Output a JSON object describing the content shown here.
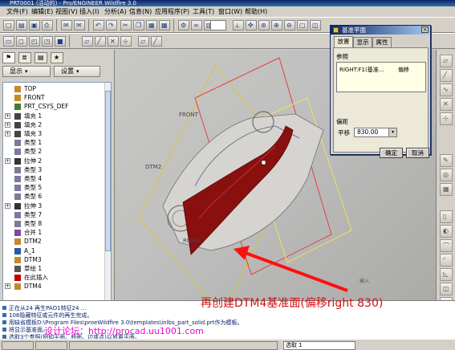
{
  "window": {
    "title": "PRT0001 (活动的) - Pro/ENGINEER Wildfire 3.0"
  },
  "menu": [
    "文件(F)",
    "编辑(E)",
    "视图(V)",
    "插入(I)",
    "分析(A)",
    "信息(N)",
    "应用程序(P)",
    "工具(T)",
    "窗口(W)",
    "帮助(H)"
  ],
  "left_panel": {
    "tabs": [
      "model-tree-tab",
      "layer-tab",
      "folder-tab",
      "favorites-tab"
    ],
    "show_label": "显示",
    "settings_label": "设置",
    "tree_items": [
      {
        "label": "TOP",
        "icon": "plane",
        "expand": false
      },
      {
        "label": "FRONT",
        "icon": "plane",
        "expand": false
      },
      {
        "label": "PRT_CSYS_DEF",
        "icon": "csys",
        "expand": false
      },
      {
        "label": "填充 1",
        "icon": "fill",
        "expand": true
      },
      {
        "label": "填充 2",
        "icon": "fill",
        "expand": true
      },
      {
        "label": "填充 3",
        "icon": "fill",
        "expand": true
      },
      {
        "label": "类型 1",
        "icon": "type",
        "expand": false
      },
      {
        "label": "类型 2",
        "icon": "type",
        "expand": false
      },
      {
        "label": "拉伸 2",
        "icon": "extrude",
        "expand": true
      },
      {
        "label": "类型 3",
        "icon": "type",
        "expand": false
      },
      {
        "label": "类型 4",
        "icon": "type",
        "expand": false
      },
      {
        "label": "类型 5",
        "icon": "type",
        "expand": false
      },
      {
        "label": "类型 6",
        "icon": "type",
        "expand": false
      },
      {
        "label": "拉伸 3",
        "icon": "extrude",
        "expand": true
      },
      {
        "label": "类型 7",
        "icon": "type",
        "expand": false
      },
      {
        "label": "类型 8",
        "icon": "type",
        "expand": false
      },
      {
        "label": "合并 1",
        "icon": "merge",
        "expand": false
      },
      {
        "label": "DTM2",
        "icon": "plane",
        "expand": false
      },
      {
        "label": "A_1",
        "icon": "axis",
        "expand": false
      },
      {
        "label": "DTM3",
        "icon": "plane",
        "expand": false
      },
      {
        "label": "草绘 1",
        "icon": "sketch",
        "expand": false
      },
      {
        "label": "在此插入",
        "icon": "insert",
        "expand": false
      },
      {
        "label": "DTM4",
        "icon": "plane",
        "expand": true
      }
    ]
  },
  "viewport": {
    "labels": {
      "front": "FRONT",
      "dtm2": "DTM2",
      "right": "RIGHT",
      "corner": "输入"
    }
  },
  "dialog": {
    "title": "基准平面",
    "close_glyph": "×",
    "tabs": [
      "放置",
      "显示",
      "属性"
    ],
    "references_label": "参照",
    "reference_item": "RIGHT:F1(基准...",
    "reference_mode": "偏移",
    "offset_section": "偏距",
    "offset_label": "平移",
    "offset_value": "830.00",
    "ok_label": "确定",
    "cancel_label": "取消"
  },
  "annotation": "再创建DTM4基准面(偏移right 830)",
  "messages": [
    "正在从24 再生PAO1特征24 ...",
    "108隐藏特征或元件的再生完成。",
    "用缺省模板D:\\Program Files\\proeWildfire 3.0\\templates\\inlbs_part_solid.prt作为模板。",
    "将显示基准面。",
    "选取3个参照(例如平面、曲面、边或点)以放置平面。"
  ],
  "watermark": "设计论坛：http://procad.uu1001.com",
  "status": {
    "filter_value": "选取 1"
  },
  "colors": {
    "dialog_title": "#0a246a",
    "annotation": "#d01010",
    "watermark": "#f000d0",
    "car_body": "#8a1010"
  }
}
